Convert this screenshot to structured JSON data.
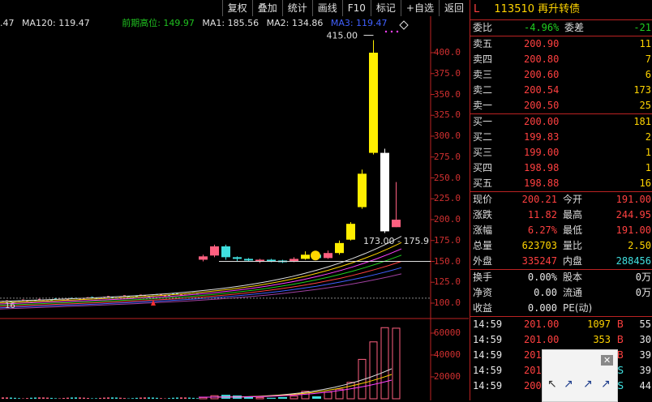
{
  "toolbar": [
    "复权",
    "叠加",
    "统计",
    "画线",
    "F10",
    "标记",
    "+自选",
    "返回"
  ],
  "ma_left": [
    ".47",
    "MA120: 119.47"
  ],
  "ma_right": [
    {
      "text": "前期高位: 149.97",
      "color": "#20c020"
    },
    {
      "text": "MA1: 185.56",
      "color": "#e0e0e0"
    },
    {
      "text": "MA2: 134.86",
      "color": "#e0e0e0"
    },
    {
      "text": "MA3: 119.47",
      "color": "#4060ff"
    }
  ],
  "price_axis": [
    "400.0",
    "375.0",
    "350.0",
    "325.0",
    "300.0",
    "275.0",
    "250.0",
    "225.0",
    "200.0",
    "175.0",
    "150.0",
    "125.0",
    "100.0"
  ],
  "volume_axis": [
    "60000",
    "40000",
    "20000"
  ],
  "annotations": {
    "high": "415.00",
    "low_range": "173.00 - 175.9",
    "left_stub": "16"
  },
  "candles": [
    {
      "o": 152,
      "c": 156,
      "h": 158,
      "l": 150,
      "color": "red"
    },
    {
      "o": 157,
      "c": 168,
      "h": 170,
      "l": 155,
      "color": "red"
    },
    {
      "o": 168,
      "c": 155,
      "h": 170,
      "l": 152,
      "color": "cyan"
    },
    {
      "o": 155,
      "c": 153,
      "h": 156,
      "l": 150,
      "color": "cyan"
    },
    {
      "o": 153,
      "c": 152,
      "h": 154,
      "l": 150,
      "color": "cyan"
    },
    {
      "o": 150,
      "c": 152,
      "h": 153,
      "l": 148,
      "color": "red"
    },
    {
      "o": 152,
      "c": 151,
      "h": 153,
      "l": 149,
      "color": "cyan"
    },
    {
      "o": 151,
      "c": 150,
      "h": 152,
      "l": 148,
      "color": "cyan"
    },
    {
      "o": 150,
      "c": 153,
      "h": 155,
      "l": 149,
      "color": "red"
    },
    {
      "o": 153,
      "c": 158,
      "h": 162,
      "l": 152,
      "color": "yellow"
    },
    {
      "o": 158,
      "c": 154,
      "h": 160,
      "l": 152,
      "color": "cyan"
    },
    {
      "o": 154,
      "c": 160,
      "h": 163,
      "l": 153,
      "color": "red"
    },
    {
      "o": 160,
      "c": 172,
      "h": 175,
      "l": 158,
      "color": "yellow"
    },
    {
      "o": 176,
      "c": 195,
      "h": 197,
      "l": 175,
      "color": "yellow"
    },
    {
      "o": 215,
      "c": 255,
      "h": 260,
      "l": 213,
      "color": "yellow"
    },
    {
      "o": 280,
      "c": 400,
      "h": 415,
      "l": 278,
      "color": "yellow"
    },
    {
      "o": 280,
      "c": 186,
      "h": 285,
      "l": 184,
      "color": "white"
    },
    {
      "o": 200,
      "c": 191,
      "h": 245,
      "l": 191,
      "color": "red"
    }
  ],
  "volumes": [
    1200,
    2800,
    3600,
    3000,
    1800,
    1200,
    900,
    1500,
    2400,
    6800,
    2200,
    6100,
    8800,
    15000,
    36000,
    52000,
    65000,
    64500
  ],
  "quote": {
    "code": "113510",
    "name": "再升转债",
    "mark": "L",
    "weibi": {
      "label": "委比",
      "value": "-4.96%"
    },
    "weicha": {
      "label": "委差",
      "value": "-21"
    },
    "asks": [
      {
        "label": "卖五",
        "price": "200.90",
        "vol": "11"
      },
      {
        "label": "卖四",
        "price": "200.80",
        "vol": "7"
      },
      {
        "label": "卖三",
        "price": "200.60",
        "vol": "6"
      },
      {
        "label": "卖二",
        "price": "200.54",
        "vol": "173"
      },
      {
        "label": "卖一",
        "price": "200.50",
        "vol": "25"
      }
    ],
    "bids": [
      {
        "label": "买一",
        "price": "200.00",
        "vol": "181"
      },
      {
        "label": "买二",
        "price": "199.83",
        "vol": "2"
      },
      {
        "label": "买三",
        "price": "199.00",
        "vol": "1"
      },
      {
        "label": "买四",
        "price": "198.98",
        "vol": "1"
      },
      {
        "label": "买五",
        "price": "198.88",
        "vol": "16"
      }
    ],
    "stats": [
      {
        "l1": "现价",
        "v1": "200.21",
        "c1": "red",
        "l2": "今开",
        "v2": "191.00",
        "c2": "red"
      },
      {
        "l1": "涨跌",
        "v1": "11.82",
        "c1": "red",
        "l2": "最高",
        "v2": "244.95",
        "c2": "red"
      },
      {
        "l1": "涨幅",
        "v1": "6.27%",
        "c1": "red",
        "l2": "最低",
        "v2": "191.00",
        "c2": "red"
      },
      {
        "l1": "总量",
        "v1": "623703",
        "c1": "yel",
        "l2": "量比",
        "v2": "2.50",
        "c2": "yel"
      },
      {
        "l1": "外盘",
        "v1": "335247",
        "c1": "red",
        "l2": "内盘",
        "v2": "288456",
        "c2": "cyan"
      }
    ],
    "stats2": [
      {
        "l1": "换手",
        "v1": "0.00%",
        "l2": "股本",
        "v2": "0万"
      },
      {
        "l1": "净资",
        "v1": "0.00",
        "l2": "流通",
        "v2": "0万"
      },
      {
        "l1": "收益",
        "v1": "0.000",
        "l2": "PE(动)",
        "v2": ""
      }
    ],
    "ticks": [
      {
        "time": "14:59",
        "price": "201.00",
        "vol": "1097",
        "side": "B",
        "extra": "55"
      },
      {
        "time": "14:59",
        "price": "201.00",
        "vol": "353",
        "side": "B",
        "extra": "30"
      },
      {
        "time": "14:59",
        "price": "201",
        "vol": "",
        "side": "B",
        "extra": "39"
      },
      {
        "time": "14:59",
        "price": "201",
        "vol": "",
        "side": "S",
        "extra": "39"
      },
      {
        "time": "14:59",
        "price": "200",
        "vol": "",
        "side": "S",
        "extra": "44"
      }
    ]
  }
}
